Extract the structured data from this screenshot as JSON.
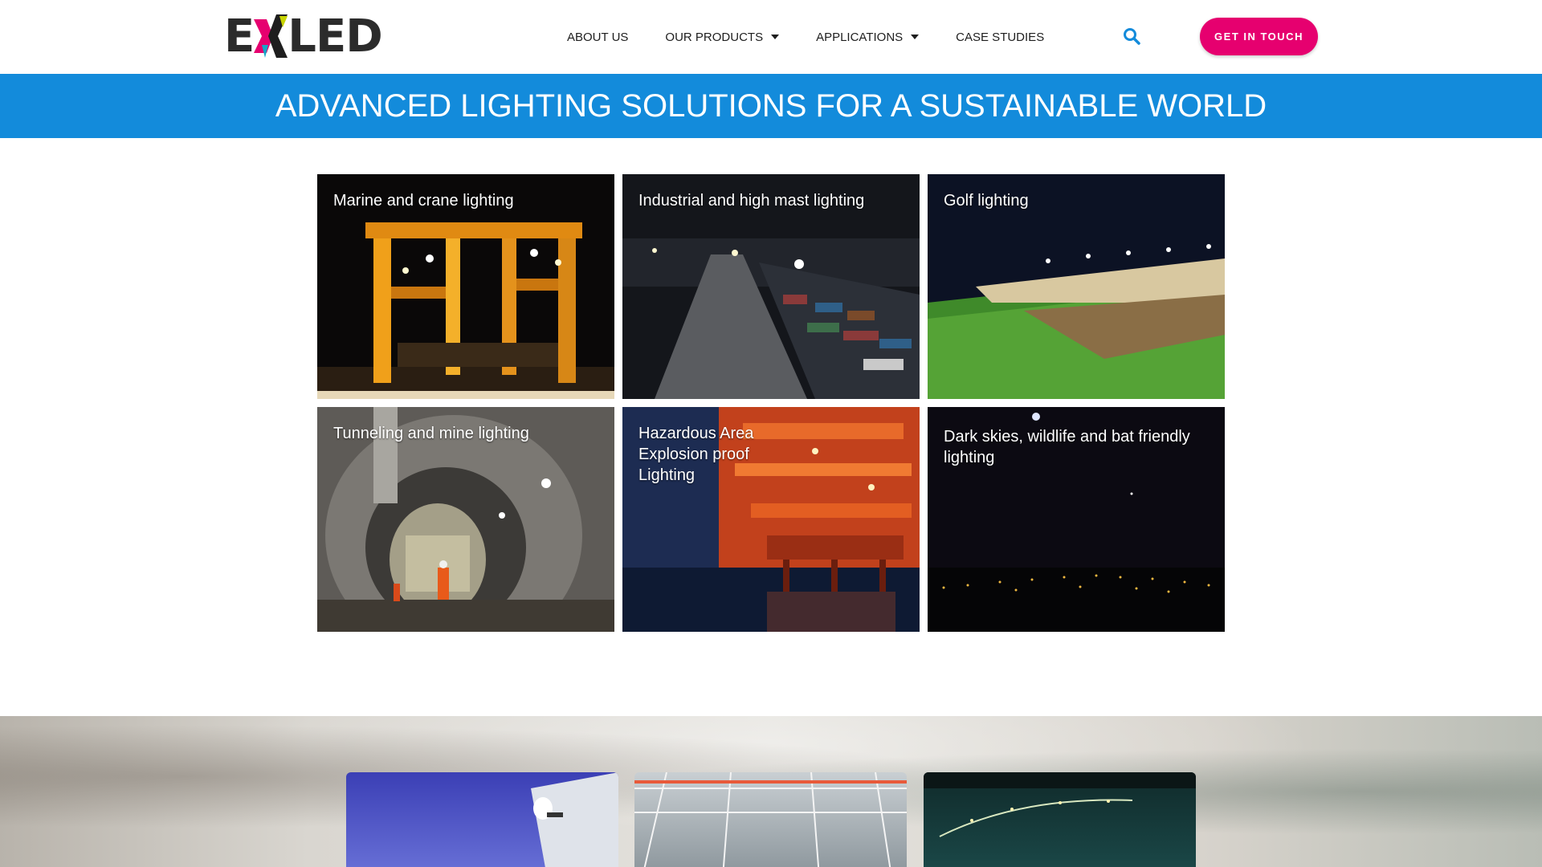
{
  "header": {
    "logo": {
      "left": "E",
      "right": "LED"
    },
    "nav": [
      {
        "label": "ABOUT US",
        "dropdown": false
      },
      {
        "label": "OUR PRODUCTS",
        "dropdown": true
      },
      {
        "label": "APPLICATIONS",
        "dropdown": true
      },
      {
        "label": "CASE STUDIES",
        "dropdown": false
      }
    ],
    "cta_label": "GET IN TOUCH"
  },
  "banner": {
    "title": "ADVANCED LIGHTING SOLUTIONS FOR A SUSTAINABLE WORLD"
  },
  "applications": [
    {
      "label": "Marine and crane lighting"
    },
    {
      "label": "Industrial and high mast lighting"
    },
    {
      "label": "Golf lighting"
    },
    {
      "label": "Tunneling and mine lighting"
    },
    {
      "label": "Hazardous Area Explosion proof Lighting"
    },
    {
      "label": "Dark skies, wildlife and bat friendly lighting"
    }
  ],
  "colors": {
    "accent_blue": "#138bdb",
    "cta_pink": "#e6006f",
    "search_blue": "#138bdb"
  }
}
